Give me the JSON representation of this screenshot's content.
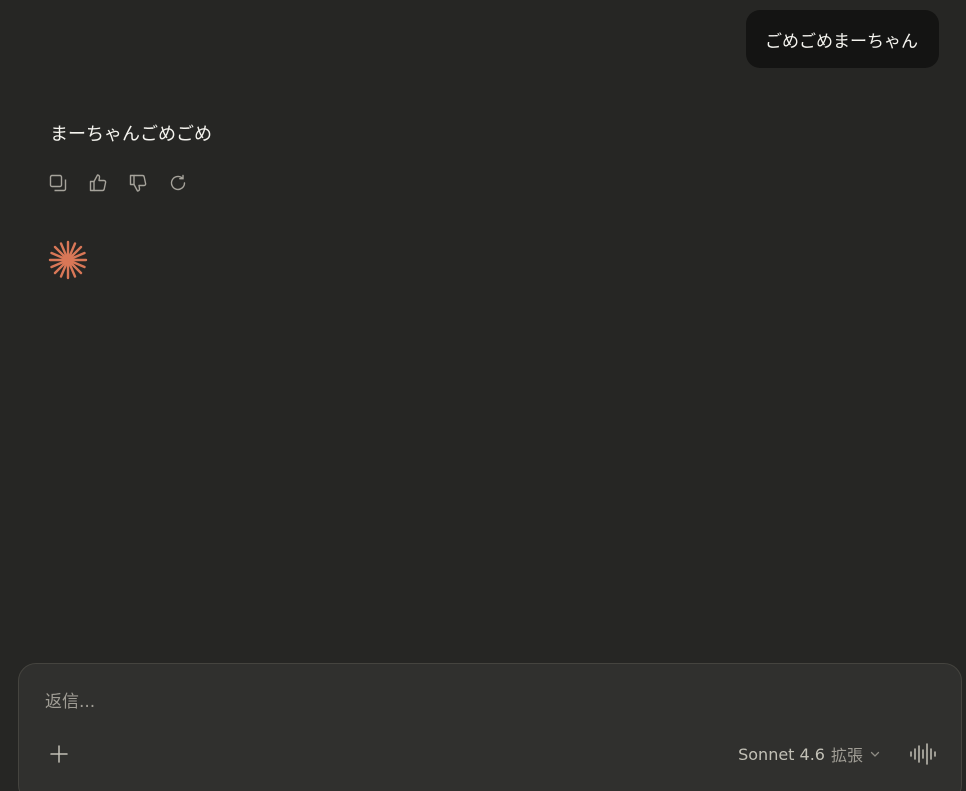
{
  "conversation": {
    "user_message": "ごめごめまーちゃん",
    "assistant_message": "まーちゃんごめごめ"
  },
  "message_actions": [
    {
      "name": "copy-icon",
      "label": "copy"
    },
    {
      "name": "thumbs-up-icon",
      "label": "like"
    },
    {
      "name": "thumbs-down-icon",
      "label": "dislike"
    },
    {
      "name": "retry-icon",
      "label": "retry"
    }
  ],
  "composer": {
    "placeholder": "返信...",
    "value": "",
    "model_name": "Sonnet 4.6",
    "model_mode": "拡張"
  },
  "colors": {
    "background": "#262624",
    "user_bubble": "#141413",
    "composer": "#30302e",
    "spark_accent": "#d97757"
  }
}
